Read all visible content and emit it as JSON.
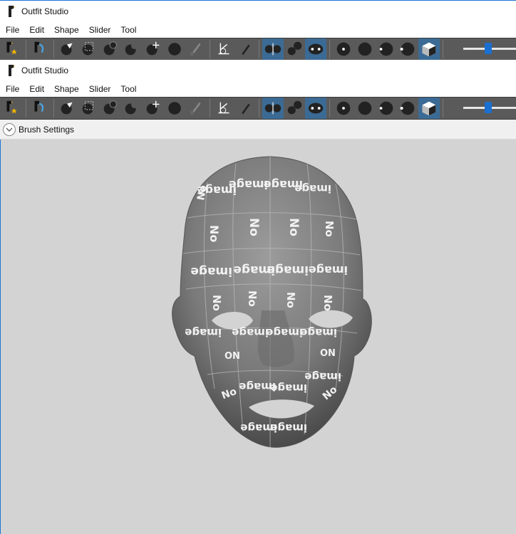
{
  "window_top": {
    "title": "Outfit Studio",
    "menu": [
      "File",
      "Edit",
      "Shape",
      "Slider",
      "Tool"
    ]
  },
  "window_main": {
    "title": "Outfit Studio",
    "menu": [
      "File",
      "Edit",
      "Shape",
      "Slider",
      "Tool"
    ],
    "brush_settings_label": "Brush Settings"
  },
  "toolbar_icons": [
    "new-project-icon",
    "load-reference-icon",
    "select-brush-icon",
    "mask-brush-icon",
    "inflate-brush-icon",
    "deflate-brush-icon",
    "move-brush-icon",
    "smooth-brush-icon",
    "weight-brush-icon",
    "transform-icon",
    "pivot-icon",
    "x-mirror-icon",
    "connected-only-icon",
    "global-brush-icon",
    "vertex-dots-icon",
    "normals-icon",
    "wireframe-icon",
    "lighting-icon",
    "textures-icon"
  ],
  "viewport_texture_text": [
    "No",
    "image"
  ],
  "colors": {
    "toolbar_bg": "#5a5a5a",
    "active_button": "#3b6b95",
    "slider_thumb": "#1a6fd0",
    "viewport_bg": "#d3d3d3",
    "accent_border": "#1e73d6"
  }
}
